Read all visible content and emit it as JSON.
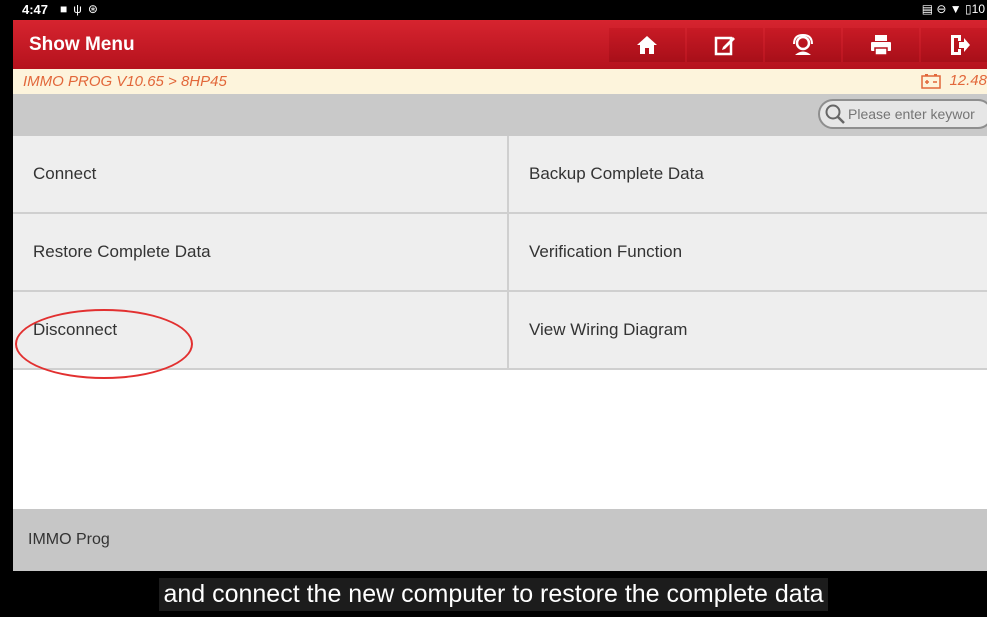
{
  "statusbar": {
    "time": "4:47",
    "left_icons": [
      "video-icon",
      "usb-icon",
      "bluetooth-icon"
    ],
    "right_icons": [
      "cast-icon",
      "dnd-icon",
      "wifi-icon",
      "battery-icon"
    ],
    "battery_text": "10"
  },
  "titlebar": {
    "title": "Show Menu",
    "buttons": [
      "home-icon",
      "edit-icon",
      "support-icon",
      "print-icon",
      "exit-icon"
    ]
  },
  "breadcrumb": {
    "path": "IMMO PROG V10.65 > 8HP45",
    "voltage": "12.48"
  },
  "search": {
    "placeholder": "Please enter keywor"
  },
  "menu": {
    "items": [
      {
        "label": "Connect"
      },
      {
        "label": "Backup Complete Data"
      },
      {
        "label": "Restore Complete Data"
      },
      {
        "label": "Verification Function"
      },
      {
        "label": "Disconnect"
      },
      {
        "label": "View Wiring Diagram"
      }
    ]
  },
  "footer": {
    "label": "IMMO Prog"
  },
  "caption": {
    "text": "and connect the new computer to restore the complete data"
  },
  "colors": {
    "brand_red": "#c81a25",
    "breadcrumb_text": "#e2673a",
    "annotation": "#e23030"
  }
}
